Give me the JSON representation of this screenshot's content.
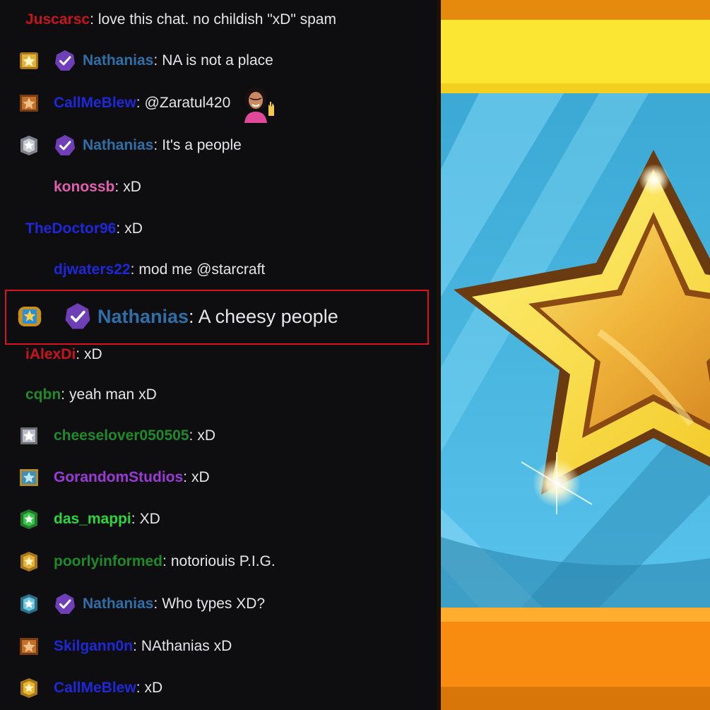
{
  "chat": {
    "messages": [
      {
        "user": "Juscarsc",
        "user_color": "#c8141c",
        "text": "love this chat. no childish \"xD\" spam",
        "badge": "none",
        "verified": false
      },
      {
        "user": "Nathanias",
        "user_color": "#2f6fa8",
        "text": "NA is not a place",
        "badge": "gold-star-badge",
        "verified": true
      },
      {
        "user": "CallMeBlew",
        "user_color": "#1f28d6",
        "text": "@Zaratul420",
        "badge": "bronze-star-badge",
        "verified": false,
        "emote": "waving-woman-emote"
      },
      {
        "user": "Nathanias",
        "user_color": "#2f6fa8",
        "text": "It's a people",
        "badge": "silver-star-badge",
        "verified": true
      },
      {
        "user": "konossb",
        "user_color": "#e25fb0",
        "text": "xD",
        "badge": "none",
        "verified": false
      },
      {
        "user": "TheDoctor96",
        "user_color": "#1f28d6",
        "text": "xD",
        "badge": "none",
        "verified": false
      },
      {
        "user": "djwaters22",
        "user_color": "#1f28d6",
        "text": "mod me @starcraft",
        "badge": "none",
        "verified": false
      },
      {
        "user": "Nathanias",
        "user_color": "#2f6fa8",
        "text": "A cheesy people",
        "badge": "blue-gold-star-badge",
        "verified": true,
        "highlighted": true
      },
      {
        "user": "iAlexDi",
        "user_color": "#c8141c",
        "text": "xD",
        "badge": "none",
        "verified": false
      },
      {
        "user": "cqbn",
        "user_color": "#1e8a2a",
        "text": "yeah man xD",
        "badge": "none",
        "verified": false
      },
      {
        "user": "cheeselover050505",
        "user_color": "#1e8a2a",
        "text": "xD",
        "badge": "silver-star-badge",
        "verified": false
      },
      {
        "user": "GorandomStudios",
        "user_color": "#9a3bd6",
        "text": "xD",
        "badge": "blue-star-badge",
        "verified": false
      },
      {
        "user": "das_mappi",
        "user_color": "#2ad63a",
        "text": "XD",
        "badge": "green-star-badge",
        "verified": false
      },
      {
        "user": "poorlyinformed",
        "user_color": "#1e8a2a",
        "text": "notoriouis P.I.G.",
        "badge": "gold-star-badge",
        "verified": false
      },
      {
        "user": "Nathanias",
        "user_color": "#2f6fa8",
        "text": "Who types XD?",
        "badge": "teal-star-badge",
        "verified": true
      },
      {
        "user": "Skilgann0n",
        "user_color": "#1f28d6",
        "text": "NAthanias xD",
        "badge": "bronze-star-badge",
        "verified": false
      },
      {
        "user": "CallMeBlew",
        "user_color": "#1f28d6",
        "text": "xD",
        "badge": "gold-star-badge",
        "verified": false
      }
    ]
  },
  "colors": {
    "chat_bg": "#0e0e10",
    "message_text": "#e6e6ea",
    "highlight_border": "#d9121e",
    "verified_purple": "#6f3fb7"
  },
  "art": {
    "icon": "gold-star-icon"
  }
}
